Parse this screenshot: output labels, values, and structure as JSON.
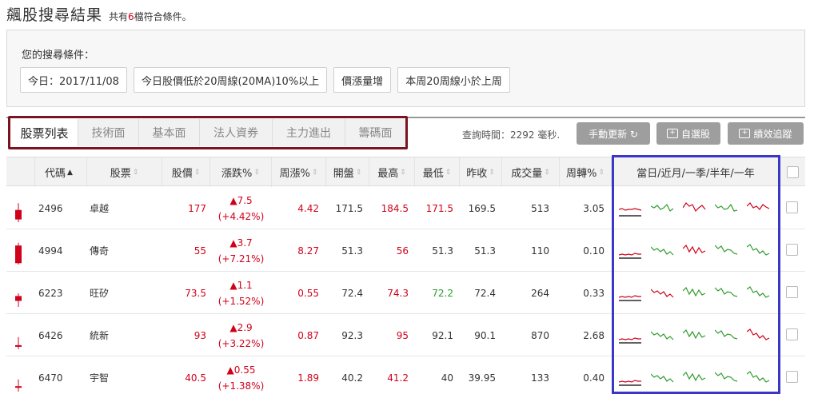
{
  "header": {
    "title": "飆股搜尋結果",
    "sub_prefix": "共有",
    "count": "6",
    "sub_suffix": "檔符合條件。"
  },
  "conditions": {
    "label": "您的搜尋條件：",
    "chips": [
      "今日：2017/11/08",
      "今日股價低於20周線(20MA)10%以上",
      "價漲量增",
      "本周20周線小於上周"
    ]
  },
  "tabs": [
    "股票列表",
    "技術面",
    "基本面",
    "法人資券",
    "主力進出",
    "籌碼面"
  ],
  "toolbar": {
    "query_time": "查詢時間：2292 毫秒.",
    "refresh_label": "手動更新 ↻",
    "watchlist_label": "自選股",
    "track_label": "績效追蹤"
  },
  "columns": {
    "code": "代碼",
    "code_sort": "▲",
    "stock": "股票",
    "price": "股價",
    "change_pct": "漲跌%",
    "week_pct": "周漲%",
    "open": "開盤",
    "high": "最高",
    "low": "最低",
    "prev_close": "昨收",
    "volume": "成交量",
    "turnover": "周轉%",
    "sparks": "當日/近月/一季/半年/一年",
    "sort_icon": "⇕"
  },
  "colors": {
    "red": "#d0021b",
    "green": "#2e9b2e",
    "tab_outline": "#7b1320",
    "spark_outline": "#3a36c8"
  },
  "rows": [
    {
      "code": "2496",
      "name": "卓越",
      "price": "177",
      "change": "▲7.5",
      "change_pct": "(+4.42%)",
      "week_pct": "4.42",
      "open": "171.5",
      "high": "184.5",
      "low": "171.5",
      "prev_close": "169.5",
      "volume": "513",
      "turnover": "3.05",
      "low_color": "red",
      "candle": {
        "body_top": 0.55,
        "body_h": 0.35,
        "wick_top": 0.3
      },
      "spark_colors": [
        "red",
        "green",
        "red",
        "green",
        "red"
      ]
    },
    {
      "code": "4994",
      "name": "傳奇",
      "price": "55",
      "change": "▲3.7",
      "change_pct": "(+7.21%)",
      "week_pct": "8.27",
      "open": "51.3",
      "high": "56",
      "low": "51.3",
      "prev_close": "51.3",
      "volume": "110",
      "turnover": "0.10",
      "low_color": "black",
      "candle": {
        "body_top": 0.3,
        "body_h": 0.65,
        "wick_top": 0.2
      },
      "spark_colors": [
        "red",
        "green",
        "red",
        "green",
        "green"
      ]
    },
    {
      "code": "6223",
      "name": "旺矽",
      "price": "73.5",
      "change": "▲1.1",
      "change_pct": "(+1.52%)",
      "week_pct": "0.55",
      "open": "72.4",
      "high": "74.3",
      "low": "72.2",
      "prev_close": "72.4",
      "volume": "264",
      "turnover": "0.33",
      "low_color": "green",
      "candle": {
        "body_top": 0.6,
        "body_h": 0.18,
        "wick_top": 0.5
      },
      "spark_colors": [
        "red",
        "red",
        "green",
        "green",
        "green"
      ]
    },
    {
      "code": "6426",
      "name": "統新",
      "price": "93",
      "change": "▲2.9",
      "change_pct": "(+3.22%)",
      "week_pct": "0.87",
      "open": "92.3",
      "high": "95",
      "low": "92.1",
      "prev_close": "90.1",
      "volume": "870",
      "turnover": "2.68",
      "low_color": "black",
      "candle": {
        "body_top": 0.85,
        "body_h": 0.06,
        "wick_top": 0.55
      },
      "spark_colors": [
        "red",
        "green",
        "green",
        "green",
        "red"
      ]
    },
    {
      "code": "6470",
      "name": "宇智",
      "price": "40.5",
      "change": "▲0.55",
      "change_pct": "(+1.38%)",
      "week_pct": "1.89",
      "open": "40.2",
      "high": "41.2",
      "low": "40",
      "prev_close": "39.95",
      "volume": "133",
      "turnover": "0.40",
      "low_color": "black",
      "candle": {
        "body_top": 0.8,
        "body_h": 0.06,
        "wick_top": 0.55
      },
      "spark_colors": [
        "red",
        "green",
        "green",
        "green",
        "green"
      ]
    }
  ]
}
